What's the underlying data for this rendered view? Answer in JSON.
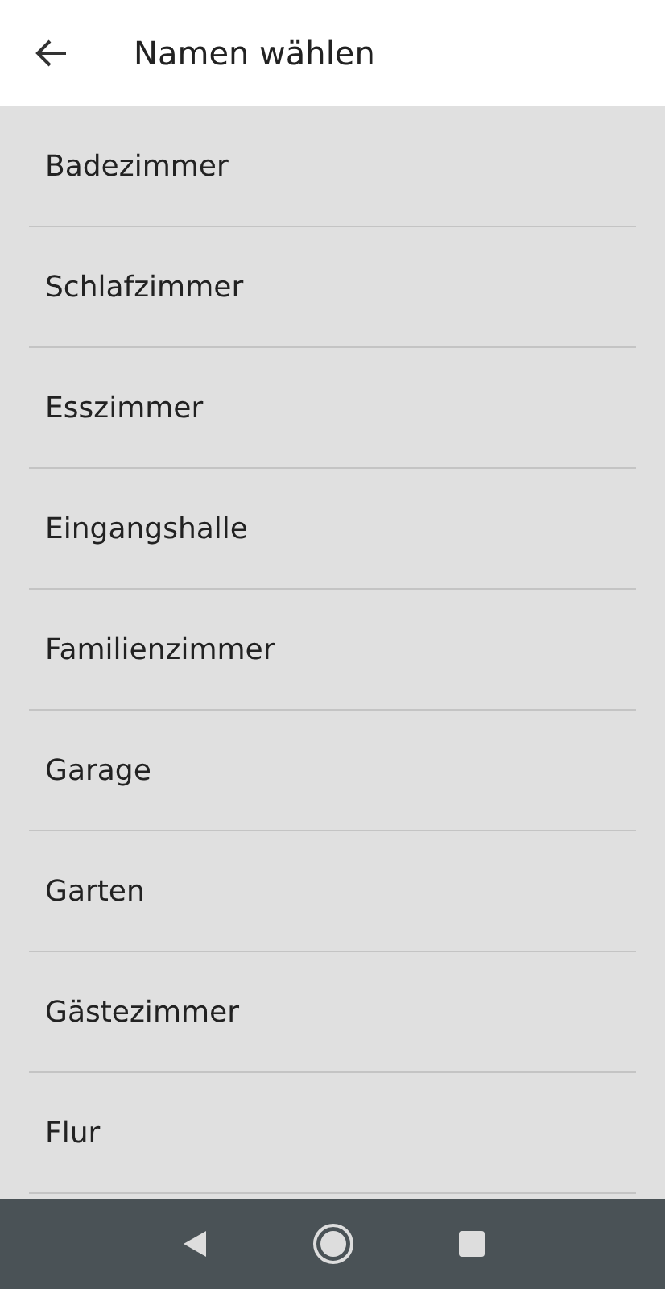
{
  "app_bar": {
    "title": "Namen wählen"
  },
  "items": [
    "Badezimmer",
    "Schlafzimmer",
    "Esszimmer",
    "Eingangshalle",
    "Familienzimmer",
    "Garage",
    "Garten",
    "Gästezimmer",
    "Flur"
  ]
}
